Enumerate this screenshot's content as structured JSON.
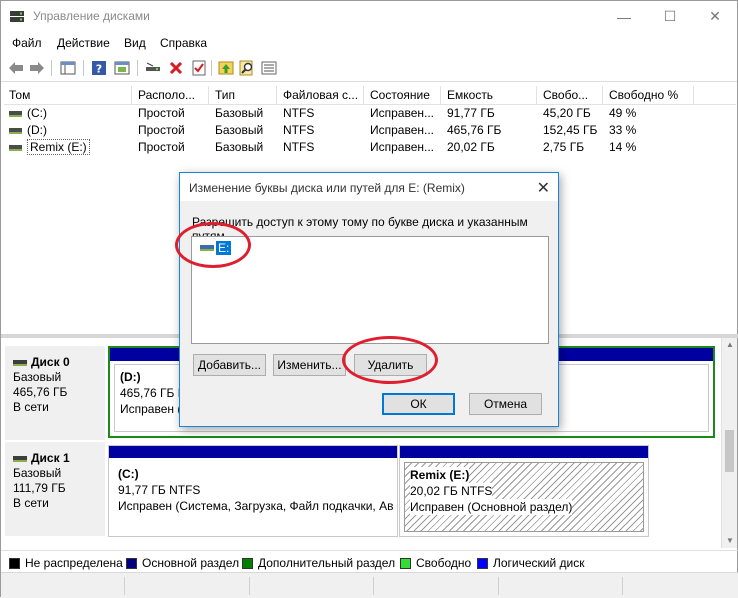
{
  "window": {
    "title": "Управление дисками",
    "minimize": "—",
    "maximize": "☐",
    "close": "✕"
  },
  "menu": [
    "Файл",
    "Действие",
    "Вид",
    "Справка"
  ],
  "volumes": {
    "columns": [
      "Том",
      "Располо...",
      "Тип",
      "Файловая с...",
      "Состояние",
      "Емкость",
      "Свобо...",
      "Свободно %"
    ],
    "rows": [
      [
        "(C:)",
        "Простой",
        "Базовый",
        "NTFS",
        "Исправен...",
        "91,77 ГБ",
        "45,20 ГБ",
        "49 %"
      ],
      [
        "(D:)",
        "Простой",
        "Базовый",
        "NTFS",
        "Исправен...",
        "465,76 ГБ",
        "152,45 ГБ",
        "33 %"
      ],
      [
        "Remix (E:)",
        "Простой",
        "Базовый",
        "NTFS",
        "Исправен...",
        "20,02 ГБ",
        "2,75 ГБ",
        "14 %"
      ]
    ]
  },
  "disks": [
    {
      "name": "Диск 0",
      "type": "Базовый",
      "size": "465,76 ГБ",
      "status": "В сети",
      "partitions": [
        {
          "label": "(D:)",
          "size": "465,76 ГБ NTFS",
          "state": "Исправен (Основной раздел)"
        }
      ]
    },
    {
      "name": "Диск 1",
      "type": "Базовый",
      "size": "111,79 ГБ",
      "status": "В сети",
      "partitions": [
        {
          "label": "(C:)",
          "size": "91,77 ГБ NTFS",
          "state": "Исправен (Система, Загрузка, Файл подкачки, Аварийный дамп, Основной раздел)"
        },
        {
          "label": "Remix  (E:)",
          "size": "20,02 ГБ NTFS",
          "state": "Исправен (Основной раздел)"
        }
      ]
    }
  ],
  "legend": [
    {
      "label": "Не распределена",
      "color": "#000000"
    },
    {
      "label": "Основной раздел",
      "color": "#000080"
    },
    {
      "label": "Дополнительный раздел",
      "color": "#008000"
    },
    {
      "label": "Свободно",
      "color": "#33dd33"
    },
    {
      "label": "Логический диск",
      "color": "#0000ff"
    }
  ],
  "dialog": {
    "title": "Изменение буквы диска или путей для E: (Remix)",
    "description": "Разрешить доступ к этому тому по букве диска и указанным путям.",
    "list_items": [
      "E:"
    ],
    "buttons": {
      "add": "Добавить...",
      "change": "Изменить...",
      "remove": "Удалить",
      "ok": "ОК",
      "cancel": "Отмена"
    },
    "close": "✕"
  },
  "colors": {
    "primary_partition": "#0000a0",
    "annotation_ring": "#dd1f2e",
    "accent": "#0078d7"
  }
}
